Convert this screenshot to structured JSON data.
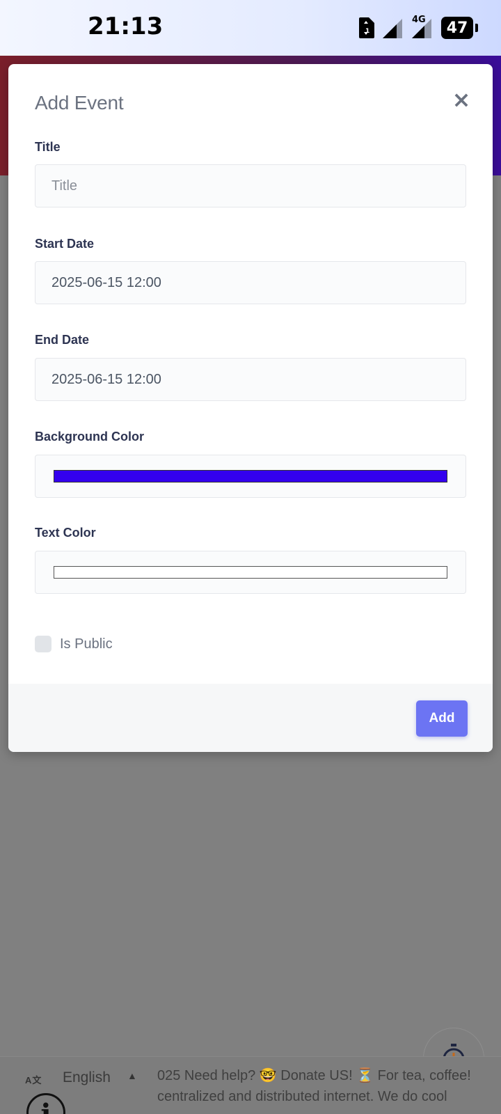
{
  "status_bar": {
    "time": "21:13",
    "network_label": "4G",
    "battery_level": "47"
  },
  "modal": {
    "title": "Add Event",
    "close_icon": "×",
    "fields": {
      "title": {
        "label": "Title",
        "placeholder": "Title",
        "value": ""
      },
      "start_date": {
        "label": "Start Date",
        "value": "2025-06-15 12:00"
      },
      "end_date": {
        "label": "End Date",
        "value": "2025-06-15 12:00"
      },
      "background_color": {
        "label": "Background Color",
        "value": "#3300ee"
      },
      "text_color": {
        "label": "Text Color",
        "value": "#ffffff"
      }
    },
    "is_public": {
      "label": "Is Public",
      "checked": false
    },
    "add_button_label": "Add"
  },
  "footer": {
    "language": "English",
    "ticker_line1": "025 Need help? 🤓 Donate US! ⏳ For tea, coffee!",
    "ticker_line2": "centralized and distributed internet. We do cool"
  },
  "colors": {
    "accent": "#6c74f3",
    "header_left": "#7a1f2a",
    "header_right": "#3a0d9a"
  }
}
